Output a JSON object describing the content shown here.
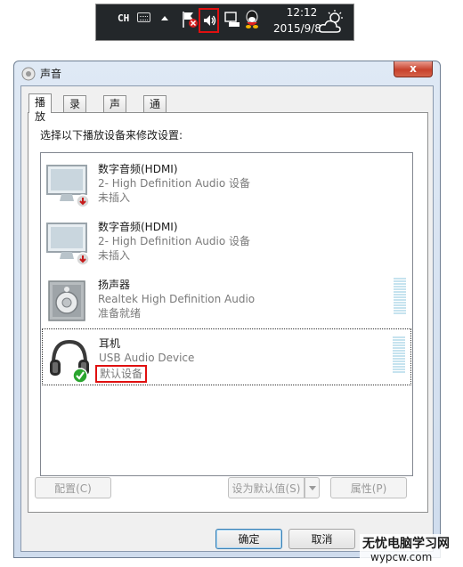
{
  "tray": {
    "lang": "CH",
    "time": "12:12",
    "date": "2015/9/8",
    "icons": [
      "keyboard-icon",
      "show-hidden-icons-arrow",
      "action-center-flag-icon",
      "speaker-volume-icon",
      "network-icon",
      "qq-icon",
      "weather-icon"
    ]
  },
  "window": {
    "title": "声音",
    "close_label": "x",
    "tabs": [
      {
        "label": "播放",
        "active": true
      },
      {
        "label": "录制",
        "active": false
      },
      {
        "label": "声音",
        "active": false
      },
      {
        "label": "通信",
        "active": false
      }
    ],
    "instruction": "选择以下播放设备来修改设置:",
    "devices": [
      {
        "name": "数字音频(HDMI)",
        "desc": "2- High Definition Audio 设备",
        "status": "未插入",
        "icon": "monitor-icon"
      },
      {
        "name": "数字音频(HDMI)",
        "desc": "2- High Definition Audio 设备",
        "status": "未插入",
        "icon": "monitor-icon"
      },
      {
        "name": "扬声器",
        "desc": "Realtek High Definition Audio",
        "status": "准备就绪",
        "icon": "speaker-icon"
      },
      {
        "name": "耳机",
        "desc": "USB Audio Device",
        "status": "默认设备",
        "icon": "headphones-icon"
      }
    ],
    "buttons": {
      "configure": "配置(C)",
      "set_default": "设为默认值(S)",
      "properties": "属性(P)",
      "ok": "确定",
      "cancel": "取消"
    }
  },
  "watermark": {
    "title": "无忧电脑学习网",
    "url": "wypcw.com"
  },
  "colors": {
    "highlight_box": "#e01010",
    "tray_bg": "#23272a",
    "window_frame": "#cfdced"
  }
}
